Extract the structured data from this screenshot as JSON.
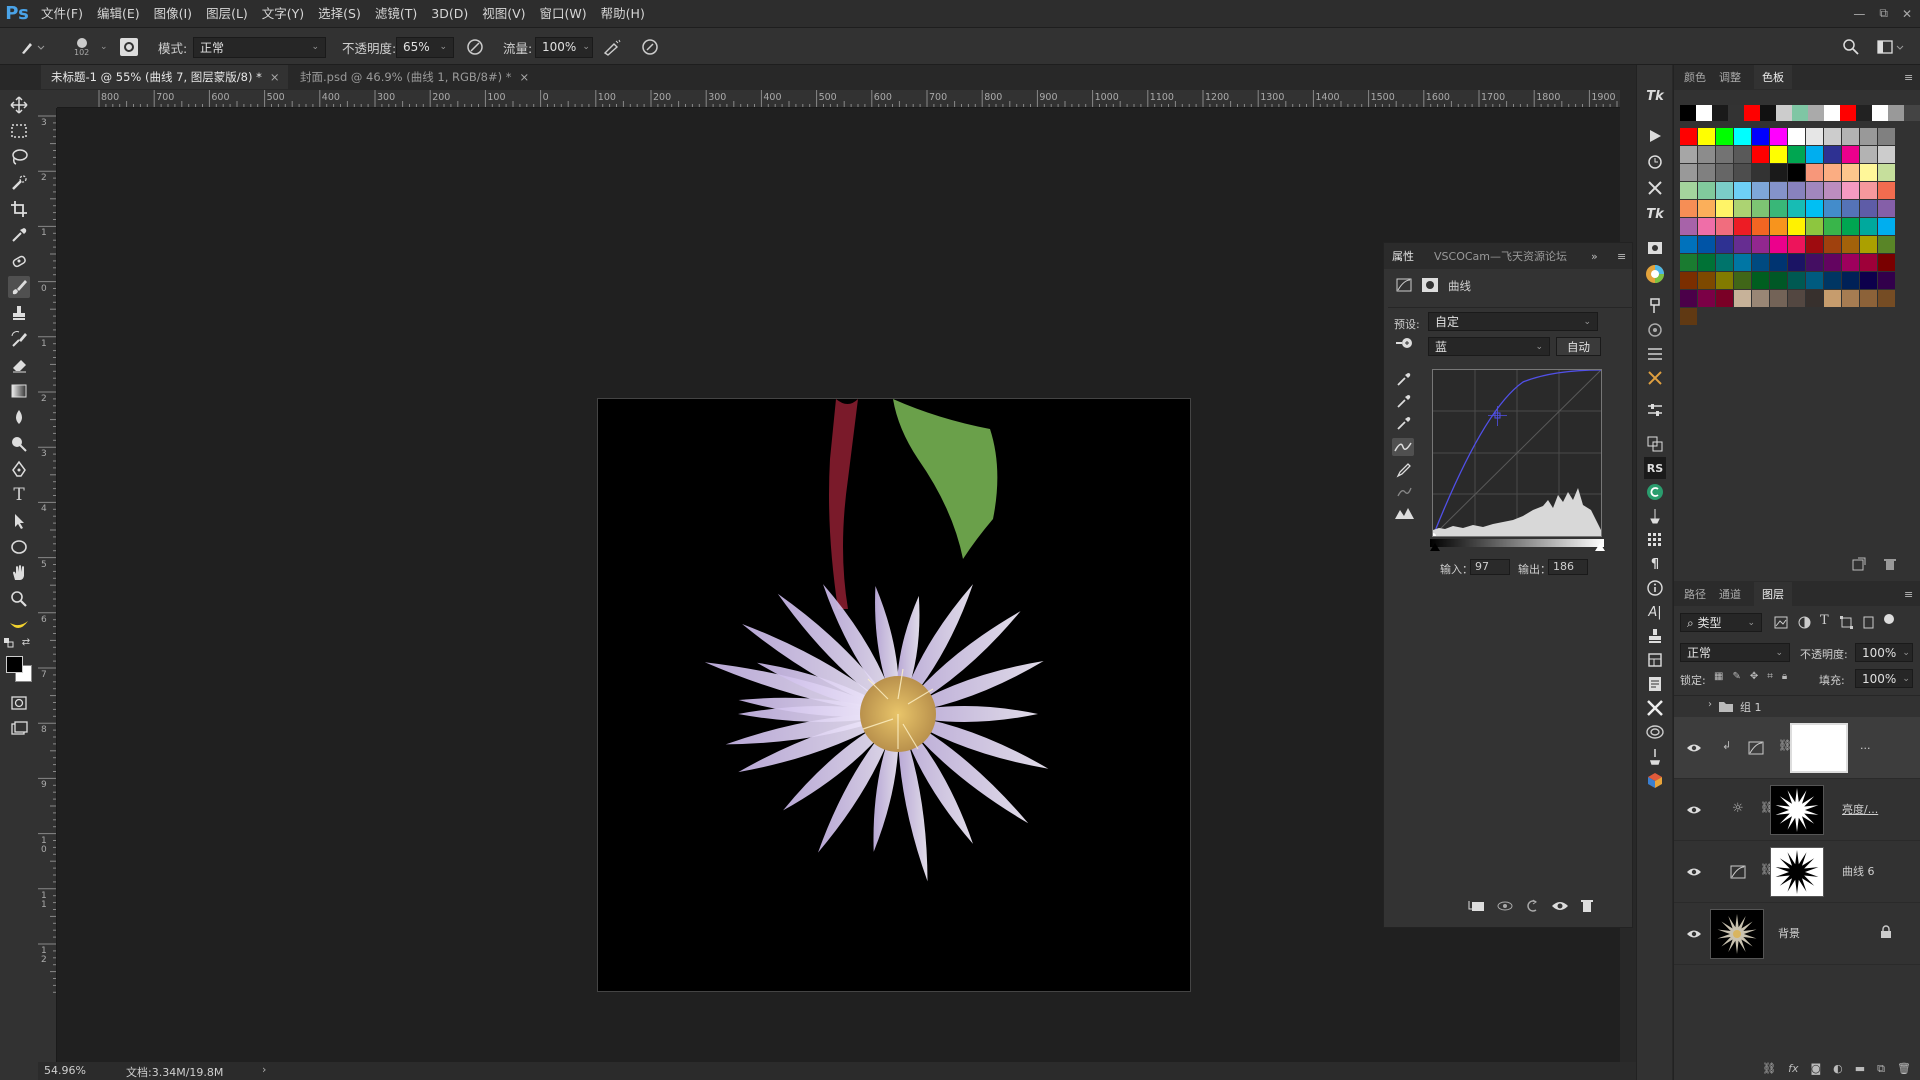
{
  "app": {
    "logo": "Ps"
  },
  "menu": [
    "文件(F)",
    "编辑(E)",
    "图像(I)",
    "图层(L)",
    "文字(Y)",
    "选择(S)",
    "滤镜(T)",
    "3D(D)",
    "视图(V)",
    "窗口(W)",
    "帮助(H)"
  ],
  "window_controls": [
    "—",
    "⧉",
    "✕"
  ],
  "options": {
    "brush_size": "102",
    "mode_label": "模式:",
    "mode_value": "正常",
    "opacity_label": "不透明度:",
    "opacity_value": "65%",
    "flow_label": "流量:",
    "flow_value": "100%"
  },
  "doc_tabs": [
    {
      "title": "未标题-1 @ 55% (曲线 7, 图层蒙版/8) *",
      "close": "×"
    },
    {
      "title": "封面.psd @ 46.9% (曲线 1, RGB/8#) *",
      "close": "×"
    }
  ],
  "ruler_h": [
    "800",
    "700",
    "600",
    "500",
    "400",
    "300",
    "200",
    "100",
    "0",
    "100",
    "200",
    "300",
    "400",
    "500",
    "600",
    "700",
    "800",
    "900",
    "1000",
    "1100",
    "1200",
    "1300",
    "1400",
    "1500",
    "1600",
    "1700",
    "1800",
    "1900"
  ],
  "ruler_v": [
    "3",
    "2",
    "1",
    "0",
    "1",
    "2",
    "3",
    "4",
    "5",
    "6",
    "7",
    "8",
    "9",
    "10",
    "11",
    "12"
  ],
  "status": {
    "zoom": "54.96%",
    "doc": "文档:3.34M/19.8M",
    "arrow": "›"
  },
  "properties": {
    "tab_props": "属性",
    "tab_vsco": "VSCOCam—飞天资源论坛",
    "expand": "»",
    "menu": "≡",
    "type_label": "曲线",
    "preset_label": "预设:",
    "preset_value": "自定",
    "channel_value": "蓝",
    "auto_button": "自动",
    "input_label": "输入：",
    "input_value": "97",
    "output_label": "输出：",
    "output_value": "186"
  },
  "right_tabs_top": [
    "颜色",
    "调整",
    "色板"
  ],
  "right_tabs_layers": [
    "路径",
    "通道",
    "图层"
  ],
  "layers_panel": {
    "filter_value": "类型",
    "blend_value": "正常",
    "opacity_label": "不透明度:",
    "opacity_value": "100%",
    "lock_label": "锁定:",
    "fill_label": "填充:",
    "fill_value": "100%",
    "group_name": "组 1",
    "layers": [
      {
        "name": "...",
        "kind": "curves"
      },
      {
        "name": "亮度/...",
        "kind": "brightness"
      },
      {
        "name": "曲线 6",
        "kind": "curves"
      },
      {
        "name": "背景",
        "kind": "background"
      }
    ]
  },
  "swatches": {
    "row1": [
      "#000000",
      "#ffffff",
      "#1a1a1a",
      "#333333",
      "#ff0000",
      "#111111",
      "#cccccc",
      "#7fc6a4",
      "#aaaaaa",
      "#ffffff",
      "#ff0000",
      "#222222",
      "#ffffff",
      "#999999",
      "#444444"
    ],
    "grid": [
      [
        "#ff0000",
        "#ffff00",
        "#00ff00",
        "#00ffff",
        "#0000ff",
        "#ff00ff",
        "#ffffff",
        "#e6e6e6",
        "#cccccc",
        "#b3b3b3",
        "#999999",
        "#808080"
      ],
      [
        "#a6a6a6",
        "#8c8c8c",
        "#737373",
        "#595959",
        "#ff0000",
        "#ffff00",
        "#00a651",
        "#00aeef",
        "#2e3192",
        "#ec008c",
        "#b3b3b3",
        "#cccccc"
      ],
      [
        "#999999",
        "#808080",
        "#666666",
        "#4d4d4d",
        "#333333",
        "#1a1a1a",
        "#000000",
        "#f7977a",
        "#fbad82",
        "#fdc68c",
        "#fff799",
        "#c6df9c"
      ],
      [
        "#a4d49d",
        "#81ca9d",
        "#7bcdc8",
        "#6ecff6",
        "#7ea7d8",
        "#8493ca",
        "#8882be",
        "#a187be",
        "#bc8dbf",
        "#f49ac2",
        "#f6989d",
        "#f26c4f"
      ],
      [
        "#f68e55",
        "#fbaf5a",
        "#fff467",
        "#acd372",
        "#7dc473",
        "#39b778",
        "#17bcb4",
        "#00bff3",
        "#438ccb",
        "#5573b7",
        "#5e5ca7",
        "#855fa8"
      ],
      [
        "#a763a9",
        "#ef6ea8",
        "#f16d7e",
        "#ed1c24",
        "#f26522",
        "#f7941d",
        "#fff200",
        "#8dc63f",
        "#39b54a",
        "#00a651",
        "#00a99d",
        "#00aeef"
      ],
      [
        "#0072bc",
        "#0054a6",
        "#2e3192",
        "#662d91",
        "#92278f",
        "#ec008c",
        "#ed145b",
        "#9e0b0f",
        "#a0410d",
        "#a3620a",
        "#aba000",
        "#598527"
      ],
      [
        "#1a7b30",
        "#007236",
        "#00746b",
        "#0076a4",
        "#004a80",
        "#003471",
        "#1b1464",
        "#440e62",
        "#630460",
        "#9e005d",
        "#9e0039",
        "#790000"
      ],
      [
        "#7b2e00",
        "#7d4900",
        "#827b00",
        "#406618",
        "#005e20",
        "#005826",
        "#005952",
        "#005b7f",
        "#003663",
        "#002157",
        "#0d004c",
        "#32004b"
      ],
      [
        "#4b0049",
        "#7b0046",
        "#7a0026",
        "#c7b299",
        "#998675",
        "#736357",
        "#534741",
        "#37302d",
        "#c69c6d",
        "#a67c52",
        "#8c6239",
        "#754c24"
      ],
      [
        "#603913"
      ]
    ]
  }
}
